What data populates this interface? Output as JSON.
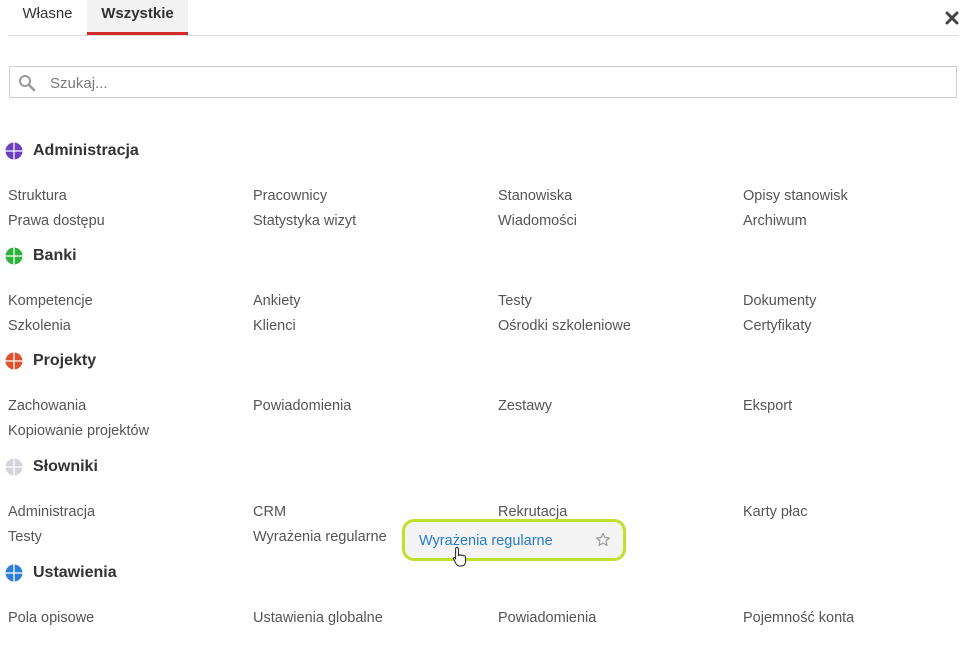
{
  "tabs": [
    {
      "label": "Własne"
    },
    {
      "label": "Wszystkie"
    }
  ],
  "search": {
    "placeholder": "Szukaj..."
  },
  "colors": {
    "accent_red": "#d62a2a",
    "highlight_green": "#bfe02c",
    "link_blue": "#2a7bc6"
  },
  "sections": [
    {
      "title": "Administracja",
      "globe_color": "#6a3fc1",
      "items": [
        "Struktura",
        "Pracownicy",
        "Stanowiska",
        "Opisy stanowisk",
        "Prawa dostępu",
        "Statystyka wizyt",
        "Wiadomości",
        "Archiwum"
      ]
    },
    {
      "title": "Banki",
      "globe_color": "#2db33a",
      "items": [
        "Kompetencje",
        "Ankiety",
        "Testy",
        "Dokumenty",
        "Szkolenia",
        "Klienci",
        "Ośrodki szkoleniowe",
        "Certyfikaty"
      ]
    },
    {
      "title": "Projekty",
      "globe_color": "#e0502e",
      "items": [
        "Zachowania",
        "Powiadomienia",
        "Zestawy",
        "Eksport",
        "Kopiowanie projektów"
      ]
    },
    {
      "title": "Słowniki",
      "globe_color": "#d4d4dc",
      "items": [
        "Administracja",
        "CRM",
        "Rekrutacja",
        "Karty płac",
        "Testy",
        "Wyrażenia regularne"
      ]
    },
    {
      "title": "Ustawienia",
      "globe_color": "#2f7fd6",
      "items": [
        "Pola opisowe",
        "Ustawienia globalne",
        "Powiadomienia",
        "Pojemność konta"
      ]
    }
  ],
  "drag_popup": {
    "label": "Wyrażenia regularne",
    "icon": "star-icon"
  }
}
